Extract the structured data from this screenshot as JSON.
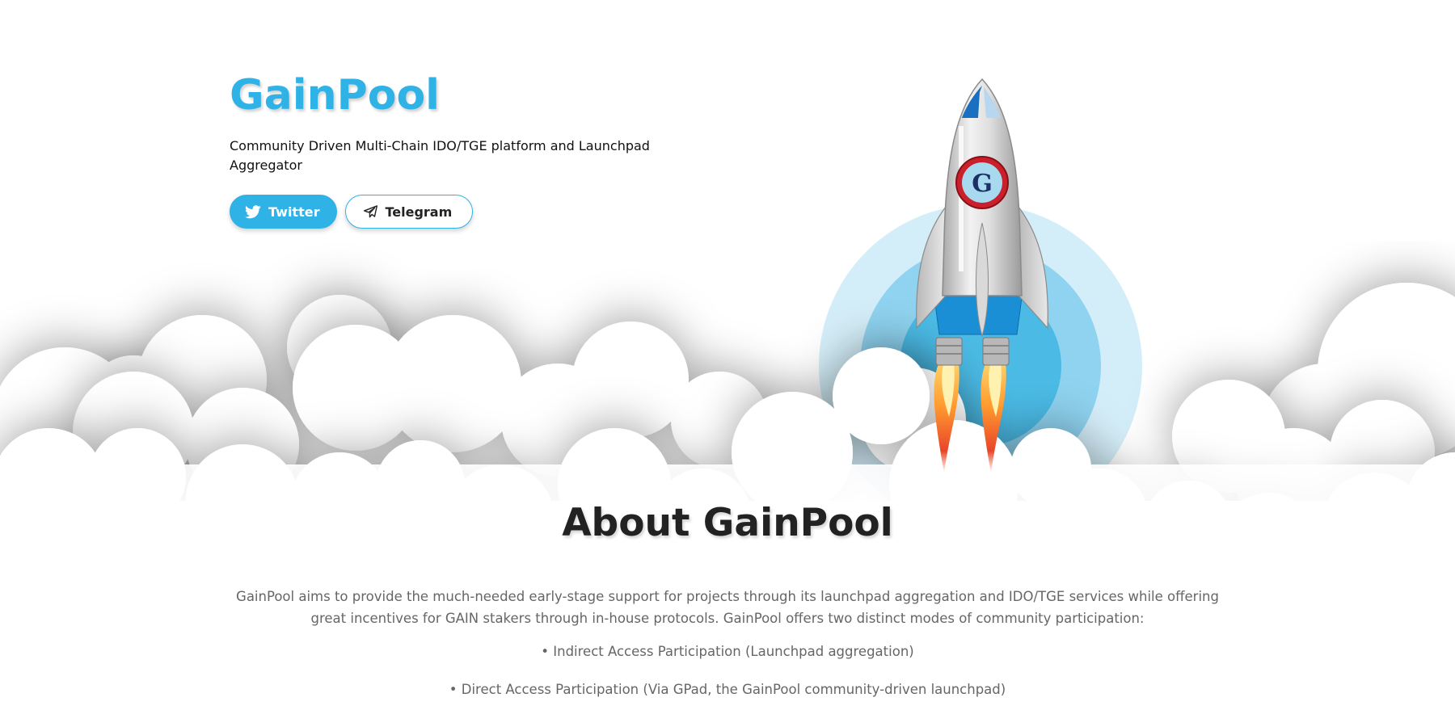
{
  "hero": {
    "brand": "GainPool",
    "tagline": "Community Driven Multi-Chain IDO/TGE platform and Launchpad Aggregator",
    "buttons": {
      "twitter": {
        "label": "Twitter",
        "icon": "twitter-bird-icon"
      },
      "telegram": {
        "label": "Telegram",
        "icon": "paper-plane-icon"
      }
    }
  },
  "rocket": {
    "logo_text": "G",
    "logo_icon": "gainpool-logo-icon"
  },
  "about": {
    "title": "About GainPool",
    "description": "GainPool aims to provide the much-needed early-stage support for projects through its launchpad aggregation and IDO/TGE services while offering great incentives for GAIN stakers through in-house protocols. GainPool offers two distinct modes of community participation:",
    "items": [
      "• Indirect Access Participation (Launchpad aggregation)",
      "• Direct Access Participation (Via GPad, the GainPool community-driven launchpad)"
    ]
  },
  "colors": {
    "accent": "#2fb2e6",
    "planet_outer": "#d4eef9",
    "planet_mid": "#8fd3f0",
    "planet_inner": "#4bbbe6",
    "heading": "#222222",
    "body_text": "#666666"
  }
}
